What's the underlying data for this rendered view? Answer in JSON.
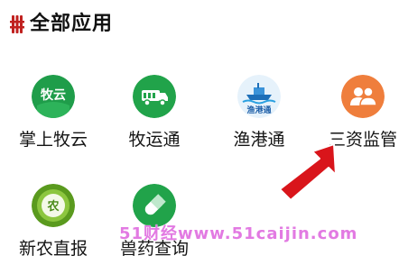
{
  "header": {
    "title": "全部应用"
  },
  "apps": [
    {
      "label": "掌上牧云",
      "icon": "muyun-icon",
      "icon_text": "牧云"
    },
    {
      "label": "牧运通",
      "icon": "truck-icon"
    },
    {
      "label": "渔港通",
      "icon": "fishing-boat-icon",
      "icon_text": "渔港通"
    },
    {
      "label": "三资监管",
      "icon": "people-icon"
    },
    {
      "label": "新农直报",
      "icon": "agriculture-badge-icon",
      "icon_text": "农"
    },
    {
      "label": "兽药查询",
      "icon": "capsule-icon"
    }
  ],
  "watermark": {
    "text": "51财经www.51caijin.com"
  },
  "colors": {
    "green": "#21a34a",
    "orange": "#ef7e3c",
    "arrow_red": "#d9151b",
    "watermark": "#e27ae2"
  }
}
